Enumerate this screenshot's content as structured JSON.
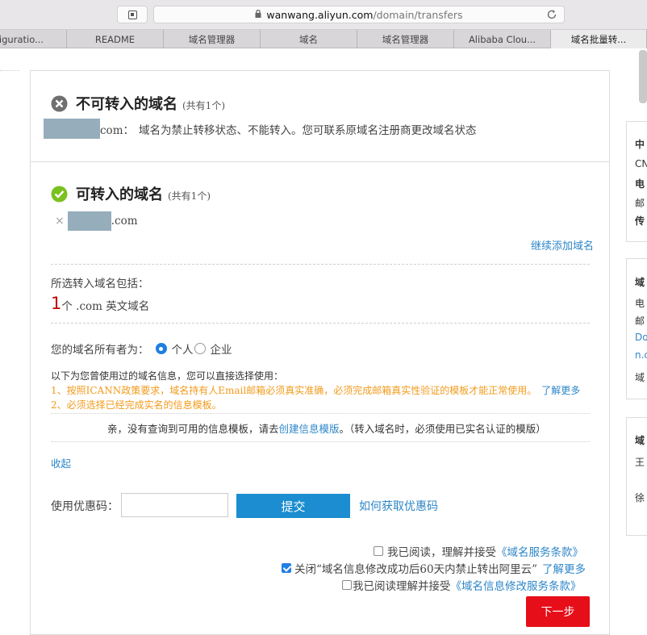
{
  "browser": {
    "url_host": "wanwang.aliyun.com",
    "url_path": "/domain/transfers",
    "tabs": [
      {
        "label": "Configuratio..."
      },
      {
        "label": "README"
      },
      {
        "label": "域名管理器"
      },
      {
        "label": "域名"
      },
      {
        "label": "域名管理器"
      },
      {
        "label": "Alibaba Clou..."
      },
      {
        "label": "域名批量转..."
      }
    ]
  },
  "not_transferable": {
    "title": "不可转入的域名",
    "count": "(共有1个)",
    "domain_suffix": "com：",
    "message": "域名为禁止转移状态、不能转入。您可联系原域名注册商更改域名状态"
  },
  "transferable": {
    "title": "可转入的域名",
    "count": "(共有1个)",
    "remove_symbol": "×",
    "domain_suffix": ".com",
    "add_more_link": "继续添加域名",
    "included_label": "所选转入域名包括：",
    "included_count": "1",
    "included_desc": "个 .com 英文域名"
  },
  "owner": {
    "label": "您的域名所有者为：",
    "options": [
      "个人",
      "企业"
    ],
    "selected": "个人"
  },
  "template_info": {
    "intro": "以下为您曾使用过的域名信息，您可以直接选择使用：",
    "notice1": "1、按照ICANN政策要求，域名持有人Email邮箱必须真实准确，必须完成邮箱真实性验证的模板才能正常使用。",
    "notice1_link": "了解更多",
    "notice2": "2、必须选择已经完成实名的信息模板。",
    "empty_prefix": "亲，没有查询到可用的信息模板，请去",
    "empty_link": "创建信息模版",
    "empty_suffix": "。（转入域名时，必须使用已实名认证的模版）",
    "collapse_link": "收起"
  },
  "coupon": {
    "label": "使用优惠码：",
    "value": "",
    "submit_label": "提交",
    "how_link": "如何获取优惠码"
  },
  "agreements": {
    "item1_text": "我已阅读，理解并接受",
    "item1_link": "《域名服务条款》",
    "item1_checked": false,
    "item2_text": "关闭“域名信息修改成功后60天内禁止转出阿里云”",
    "item2_link": "了解更多",
    "item2_checked": true,
    "item3_text": "我已阅读理解并接受",
    "item3_link": "《域名信息修改服务条款》",
    "item3_checked": false
  },
  "next_label": "下一步",
  "right_sidebar": {
    "card1": [
      "中",
      "CN",
      "电",
      "邮",
      "传"
    ],
    "card2": [
      "域",
      "电",
      "邮",
      "Do",
      "n.c",
      "域"
    ],
    "card3": [
      "域",
      "王",
      "徐"
    ]
  },
  "colors": {
    "accent_blue": "#2e86c8",
    "error_gray": "#6f6f6f",
    "success_green": "#7bc11f",
    "warning_orange": "#f29b1d",
    "primary_red": "#e60e19",
    "count_red": "#c00000"
  }
}
